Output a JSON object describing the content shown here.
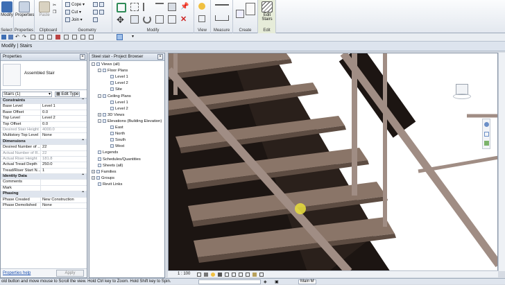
{
  "ribbon": {
    "groups": [
      {
        "label": "Select",
        "buttons": [
          "Modify"
        ]
      },
      {
        "label": "Properties",
        "buttons": [
          "Properties"
        ]
      },
      {
        "label": "Clipboard",
        "buttons": [
          "Paste"
        ]
      },
      {
        "label": "Geometry",
        "buttons": [
          "Cope",
          "Cut",
          "Join"
        ]
      },
      {
        "label": "Modify",
        "buttons": []
      },
      {
        "label": "View",
        "buttons": []
      },
      {
        "label": "Measure",
        "buttons": []
      },
      {
        "label": "Create",
        "buttons": []
      },
      {
        "label": "Edit",
        "buttons": [
          "Edit Stairs"
        ]
      }
    ]
  },
  "context_bar": {
    "text": "Modify | Stairs"
  },
  "properties": {
    "title": "Properties",
    "type_name": "Assembled Stair",
    "filter": "Stairs (1)",
    "edit_type": "Edit Type",
    "help": "Properties help",
    "apply": "Apply",
    "rows": [
      {
        "kind": "section",
        "key": "Constraints"
      },
      {
        "key": "Base Level",
        "value": "Level 1"
      },
      {
        "key": "Base Offset",
        "value": "0.0"
      },
      {
        "key": "Top Level",
        "value": "Level 2"
      },
      {
        "key": "Top Offset",
        "value": "0.0"
      },
      {
        "key": "Desired Stair Height",
        "value": "4000.0",
        "grey": true
      },
      {
        "key": "Multistory Top Level",
        "value": "None"
      },
      {
        "kind": "section",
        "key": "Dimensions"
      },
      {
        "key": "Desired Number of ...",
        "value": "22"
      },
      {
        "key": "Actual Number of R...",
        "value": "22",
        "grey": true
      },
      {
        "key": "Actual Riser Height",
        "value": "181.8",
        "grey": true
      },
      {
        "key": "Actual Tread Depth",
        "value": "250.0"
      },
      {
        "key": "Tread/Riser Start N...",
        "value": "1"
      },
      {
        "kind": "section",
        "key": "Identity Data"
      },
      {
        "key": "Comments",
        "value": ""
      },
      {
        "key": "Mark",
        "value": ""
      },
      {
        "kind": "section",
        "key": "Phasing"
      },
      {
        "key": "Phase Created",
        "value": "New Construction"
      },
      {
        "key": "Phase Demolished",
        "value": "None"
      }
    ]
  },
  "browser": {
    "title": "Steel stair - Project Browser",
    "nodes": [
      {
        "label": "Views (all)",
        "depth": 0,
        "toggle": "-"
      },
      {
        "label": "Floor Plans",
        "depth": 1,
        "toggle": "-"
      },
      {
        "label": "Level 1",
        "depth": 2
      },
      {
        "label": "Level 2",
        "depth": 2
      },
      {
        "label": "Site",
        "depth": 2
      },
      {
        "label": "Ceiling Plans",
        "depth": 1,
        "toggle": "-"
      },
      {
        "label": "Level 1",
        "depth": 2
      },
      {
        "label": "Level 2",
        "depth": 2
      },
      {
        "label": "3D Views",
        "depth": 1,
        "toggle": "+"
      },
      {
        "label": "Elevations (Building Elevation)",
        "depth": 1,
        "toggle": "-"
      },
      {
        "label": "East",
        "depth": 2
      },
      {
        "label": "North",
        "depth": 2
      },
      {
        "label": "South",
        "depth": 2
      },
      {
        "label": "West",
        "depth": 2
      },
      {
        "label": "Legends",
        "depth": 0
      },
      {
        "label": "Schedules/Quantities",
        "depth": 0
      },
      {
        "label": "Sheets (all)",
        "depth": 0
      },
      {
        "label": "Families",
        "depth": 0,
        "toggle": "+"
      },
      {
        "label": "Groups",
        "depth": 0,
        "toggle": "+"
      },
      {
        "label": "Revit Links",
        "depth": 0
      }
    ]
  },
  "viewport": {
    "scale": "1 : 100"
  },
  "status_bar": {
    "message": "old button and move mouse to Scroll the view. Hold Ctrl key to Zoom. Hold Shift key to Spin.",
    "model": "Main M"
  },
  "colors": {
    "tread": "#8a7568",
    "rail": "#a08d84",
    "background": "#ffffff",
    "ribbon": "#e3e8ef"
  }
}
